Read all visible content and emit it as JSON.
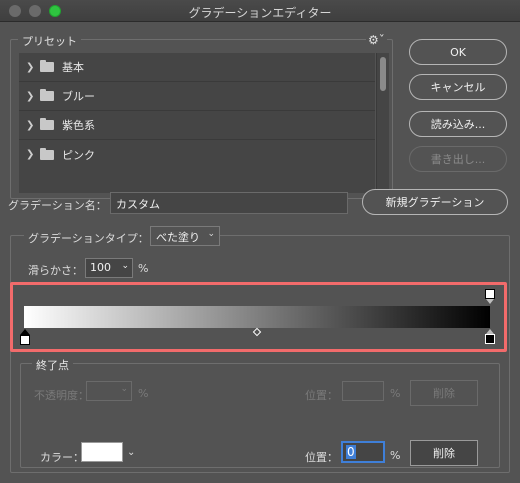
{
  "window": {
    "title": "グラデーションエディター"
  },
  "presets": {
    "label": "プリセット",
    "gear_icon": "gear-icon",
    "items": [
      {
        "label": "基本"
      },
      {
        "label": "ブルー"
      },
      {
        "label": "紫色系"
      },
      {
        "label": "ピンク"
      }
    ]
  },
  "buttons": {
    "ok": "OK",
    "cancel": "キャンセル",
    "load": "読み込み...",
    "save": "書き出し...",
    "new_gradient": "新規グラデーション"
  },
  "name": {
    "label": "グラデーション名：",
    "value": "カスタム"
  },
  "gradient_type": {
    "label": "グラデーションタイプ：",
    "selected": "べた塗り"
  },
  "smoothness": {
    "label": "滑らかさ：",
    "value": "100",
    "unit": "%"
  },
  "gradient": {
    "start_color": "#ffffff",
    "end_color": "#000000",
    "highlight_color": "#f26b6b"
  },
  "stops": {
    "label": "終了点",
    "opacity_label": "不透明度：",
    "opacity_value": "",
    "opacity_unit": "%",
    "opacity_position_label": "位置：",
    "opacity_position_value": "",
    "opacity_position_unit": "%",
    "opacity_delete": "削除",
    "color_label": "カラー：",
    "color_value": "#ffffff",
    "color_position_label": "位置：",
    "color_position_value": "0",
    "color_position_unit": "%",
    "color_delete": "削除"
  }
}
